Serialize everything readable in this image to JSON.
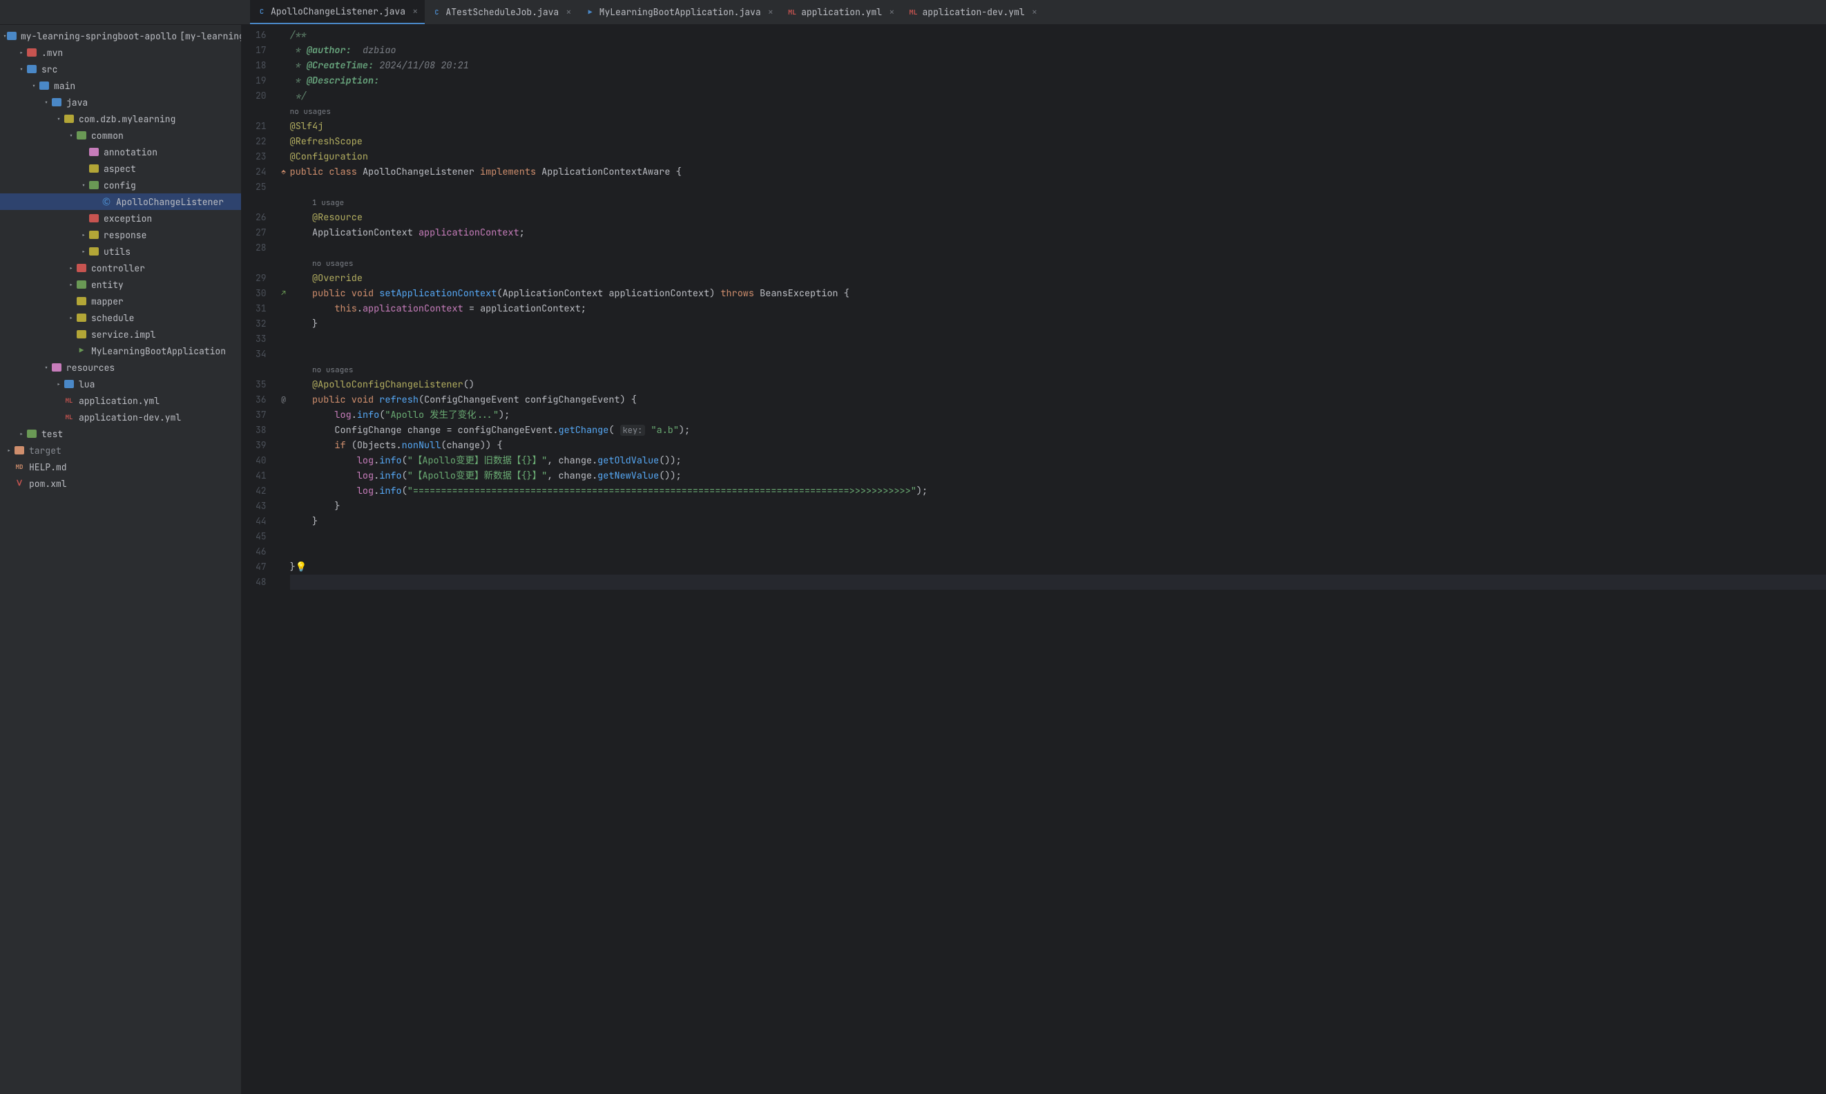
{
  "tabs": [
    {
      "label": "ApolloChangeListener.java",
      "icon": "class-icon",
      "active": true
    },
    {
      "label": "ATestScheduleJob.java",
      "icon": "class-icon",
      "active": false
    },
    {
      "label": "MyLearningBootApplication.java",
      "icon": "class-icon-run",
      "active": false
    },
    {
      "label": "application.yml",
      "icon": "yml-icon",
      "active": false
    },
    {
      "label": "application-dev.yml",
      "icon": "yml-icon",
      "active": false
    }
  ],
  "sidebar": {
    "root": {
      "label": "my-learning-springboot-apollo",
      "suffix": "[my-learning-spring…"
    },
    "items": [
      {
        "depth": 1,
        "chev": "right",
        "icon": "#c75450",
        "label": ".mvn"
      },
      {
        "depth": 1,
        "chev": "down",
        "icon": "#4a88c7",
        "label": "src"
      },
      {
        "depth": 2,
        "chev": "down",
        "icon": "#4a88c7",
        "label": "main"
      },
      {
        "depth": 3,
        "chev": "down",
        "icon": "#4a88c7",
        "label": "java",
        "overlay": "blue-src"
      },
      {
        "depth": 4,
        "chev": "down",
        "icon": "#b3a637",
        "label": "com.dzb.mylearning"
      },
      {
        "depth": 5,
        "chev": "down",
        "icon": "#6a9955",
        "label": "common"
      },
      {
        "depth": 6,
        "chev": "",
        "icon": "#c77dbb",
        "label": "annotation"
      },
      {
        "depth": 6,
        "chev": "",
        "icon": "#b3a637",
        "label": "aspect"
      },
      {
        "depth": 6,
        "chev": "down",
        "icon": "#6a9955",
        "label": "config"
      },
      {
        "depth": 7,
        "chev": "",
        "icon": "class",
        "label": "ApolloChangeListener",
        "selected": true
      },
      {
        "depth": 6,
        "chev": "",
        "icon": "#c75450",
        "label": "exception"
      },
      {
        "depth": 6,
        "chev": "right",
        "icon": "#b3a637",
        "label": "response"
      },
      {
        "depth": 6,
        "chev": "right",
        "icon": "#b3a637",
        "label": "utils"
      },
      {
        "depth": 5,
        "chev": "right",
        "icon": "#c75450",
        "label": "controller"
      },
      {
        "depth": 5,
        "chev": "right",
        "icon": "#6a9955",
        "label": "entity"
      },
      {
        "depth": 5,
        "chev": "",
        "icon": "#b3a637",
        "label": "mapper"
      },
      {
        "depth": 5,
        "chev": "right",
        "icon": "#b3a637",
        "label": "schedule"
      },
      {
        "depth": 5,
        "chev": "",
        "icon": "#b3a637",
        "label": "service.impl"
      },
      {
        "depth": 5,
        "chev": "",
        "icon": "class-run",
        "label": "MyLearningBootApplication"
      },
      {
        "depth": 3,
        "chev": "down",
        "icon": "#c77dbb",
        "label": "resources",
        "overlay": "res"
      },
      {
        "depth": 4,
        "chev": "right",
        "icon": "#4a88c7",
        "label": "lua"
      },
      {
        "depth": 4,
        "chev": "",
        "icon": "yml",
        "label": "application.yml"
      },
      {
        "depth": 4,
        "chev": "",
        "icon": "yml",
        "label": "application-dev.yml"
      },
      {
        "depth": 1,
        "chev": "right",
        "icon": "#6a9955",
        "label": "test"
      },
      {
        "depth": 0,
        "chev": "right",
        "icon": "#cf8e6d",
        "label": "target",
        "muted": true
      },
      {
        "depth": 0,
        "chev": "",
        "icon": "md",
        "label": "HELP.md"
      },
      {
        "depth": 0,
        "chev": "",
        "icon": "maven",
        "label": "pom.xml"
      }
    ]
  },
  "editor": {
    "first_line": 16,
    "last_line": 48,
    "hints": {
      "line20_after": "no usages",
      "line25_after": "1 usage",
      "line28_after": "no usages",
      "line34_after": "no usages"
    },
    "gutter_icons": {
      "24": "impl",
      "30": "override",
      "36": "at"
    },
    "tokens": {
      "doc_author": "@author:",
      "doc_author_val": "dzbiao",
      "doc_create": "@CreateTime:",
      "doc_create_val": "2024/11/08 20:21",
      "doc_desc": "@Description:",
      "ann_slf4j": "@Slf4j",
      "ann_refresh": "@RefreshScope",
      "ann_config": "@Configuration",
      "class_decl_kw1": "public",
      "class_decl_kw2": "class",
      "class_name": "ApolloChangeListener",
      "class_impl": "implements",
      "class_iface": "ApplicationContextAware",
      "ann_resource": "@Resource",
      "field_type": "ApplicationContext",
      "field_name": "applicationContext",
      "ann_override": "@Override",
      "m1_kw1": "public",
      "m1_kw2": "void",
      "m1_name": "setApplicationContext",
      "m1_ptype": "ApplicationContext",
      "m1_pname": "applicationContext",
      "m1_throws": "throws",
      "m1_exc": "BeansException",
      "m1_body_this": "this",
      "m1_body_field": "applicationContext",
      "m1_body_param": "applicationContext",
      "ann_apollo": "@ApolloConfigChangeListener",
      "m2_kw1": "public",
      "m2_kw2": "void",
      "m2_name": "refresh",
      "m2_ptype": "ConfigChangeEvent",
      "m2_pname": "configChangeEvent",
      "log": "log",
      "info": "info",
      "str1": "\"Apollo 发生了变化...\"",
      "cc_type": "ConfigChange",
      "cc_var": "change",
      "cc_expr_obj": "configChangeEvent",
      "cc_expr_m": "getChange",
      "cc_hint": "key:",
      "cc_key": "\"a.b\"",
      "if_kw": "if",
      "objects": "Objects",
      "nonnull": "nonNull",
      "str_old": "\"【Apollo变更】旧数据【{}】\"",
      "str_new": "\"【Apollo变更】新数据【{}】\"",
      "getOld": "getOldValue",
      "getNew": "getNewValue",
      "str_sep": "\"==============================================================================>>>>>>>>>>>\""
    }
  }
}
